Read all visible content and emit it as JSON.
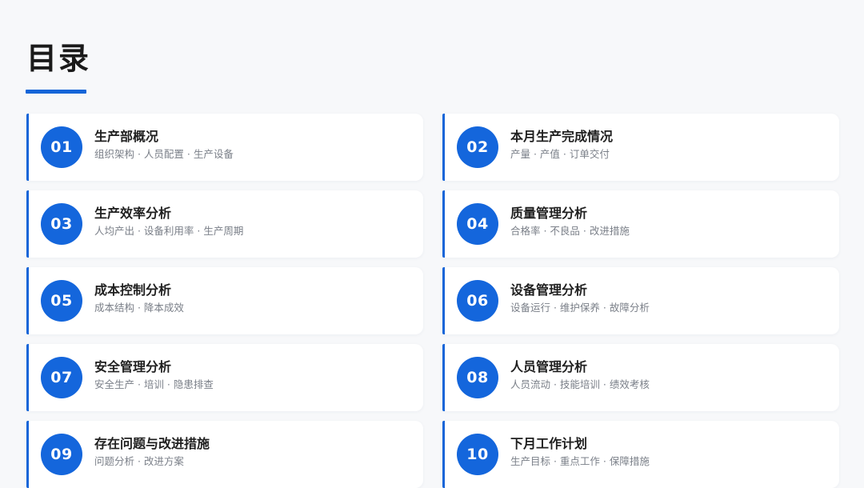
{
  "page": {
    "title": "目录",
    "accent_color": "#1565d8"
  },
  "toc": [
    {
      "number": "01",
      "title": "生产部概况",
      "subtitle": "组织架构 · 人员配置 · 生产设备"
    },
    {
      "number": "02",
      "title": "本月生产完成情况",
      "subtitle": "产量 · 产值 · 订单交付"
    },
    {
      "number": "03",
      "title": "生产效率分析",
      "subtitle": "人均产出 · 设备利用率 · 生产周期"
    },
    {
      "number": "04",
      "title": "质量管理分析",
      "subtitle": "合格率 · 不良品 · 改进措施"
    },
    {
      "number": "05",
      "title": "成本控制分析",
      "subtitle": "成本结构 · 降本成效"
    },
    {
      "number": "06",
      "title": "设备管理分析",
      "subtitle": "设备运行 · 维护保养 · 故障分析"
    },
    {
      "number": "07",
      "title": "安全管理分析",
      "subtitle": "安全生产 · 培训 · 隐患排查"
    },
    {
      "number": "08",
      "title": "人员管理分析",
      "subtitle": "人员流动 · 技能培训 · 绩效考核"
    },
    {
      "number": "09",
      "title": "存在问题与改进措施",
      "subtitle": "问题分析 · 改进方案"
    },
    {
      "number": "10",
      "title": "下月工作计划",
      "subtitle": "生产目标 · 重点工作 · 保障措施"
    }
  ]
}
